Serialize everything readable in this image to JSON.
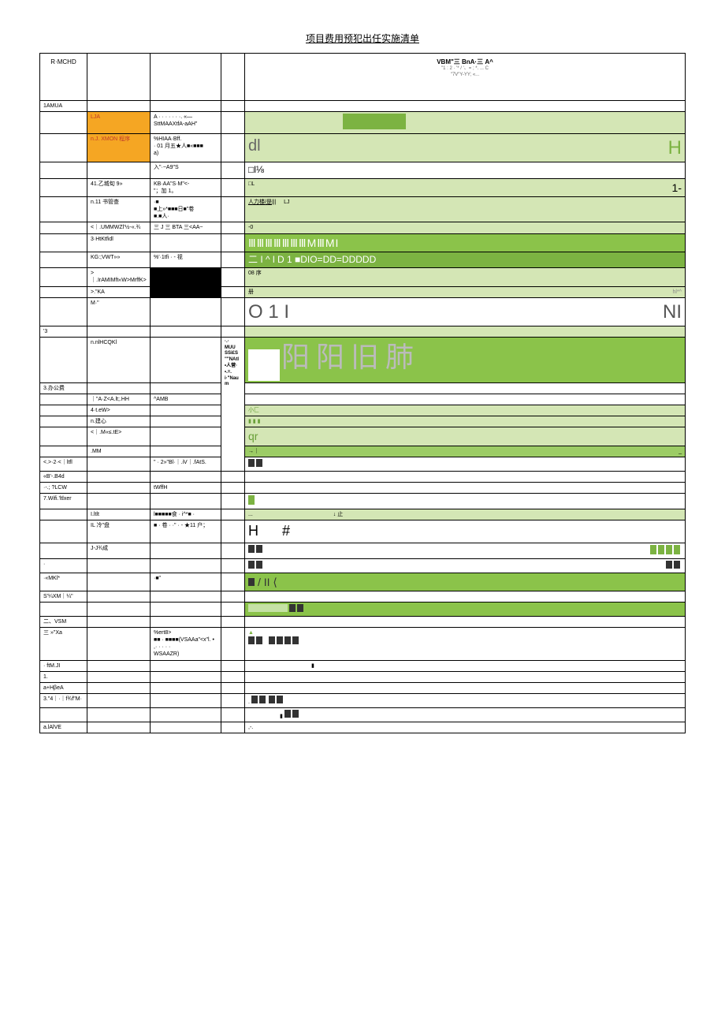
{
  "title": "项目费用预犯出任实施清单",
  "header": {
    "col1": "R·MCHD",
    "right_line1": "VBM\"三 BnA·三 A^",
    "right_line2": "\"1 : 2 · '* / '、= ; *. ... C",
    "right_line3": "\"7V\"Y-YY; «..."
  },
  "rows": [
    {
      "c1": "1AMUA",
      "c2": "",
      "c3": "",
      "c5": ""
    },
    {
      "c1": "",
      "c2": "LJA",
      "c2cls": "orange",
      "c3": "A · · · · · · ·. «—\nSttMAAXtfA-aAH\"",
      "c5cls": "lightgreen",
      "c5html": "<span style='position:relative;display:inline-block;width:100%'><span style='display:inline-block;width:80px;height:20px;background:#7cb342;margin-left:120px'></span></span>"
    },
    {
      "c1": "",
      "c2": "n.J. XMON 程序",
      "c2cls": "orange",
      "c3": "%HIAA·Bff.\n· 01 月五★人■«■■■\na)",
      "c5cls": "lightgreen",
      "c5html": "<span class='big-text'>dl</span><span style='float:right;font-size:24px;color:#7cb342'>H</span>"
    },
    {
      "c1": "",
      "c2": "",
      "c3": "入\"·~A9\"S",
      "c5": "□l⅛",
      "c5style": "font-size:12px"
    },
    {
      "c1": "",
      "c2": "41.乙城旬 9»",
      "c3": "KB·AA\"S·M\"<-\n\"；加 1。",
      "c5cls": "lightgreen",
      "c5html": "□L<span style='float:right;font-size:14px'>1-</span>"
    },
    {
      "c1": "",
      "c2": "n.11 书管查",
      "c3": "·■\n■上»*■■■日■\"卷\n■.■人·",
      "c5cls": "lightgreen",
      "c5html": "<u>人力楼/是</u>||| &nbsp;&nbsp;&nbsp; LJ"
    },
    {
      "c1": "",
      "c2": "<｜.UMMWZl'½-«.¾",
      "c3": "三 J 三 BTA 三<AA~",
      "c5cls": "lightgreen",
      "c5": "-0"
    },
    {
      "c1": "",
      "c2": "3·HtKtfidl",
      "c3": "",
      "c5cls": "brightgreen",
      "c5html": "<span style='font-size:14px;letter-spacing:1px'>ⅢⅢⅢⅢⅢⅢⅢMⅢMI</span>"
    },
    {
      "c1": "",
      "c2": "KG:;VWT»»",
      "c3": "%'·1tfi · - 视",
      "c5cls": "green",
      "c5html": "<span style='color:#fff;font-size:12px'>二 I ^ l D 1 ■DIO=DD=DDDDD</span>"
    },
    {
      "c1": "",
      "c2": ">｜.IrAMIMft«W>MrffK>",
      "c3": "",
      "c3cls": "black",
      "c5cls": "lightgreen",
      "c5": "08 序"
    },
    {
      "c1": "",
      "c2": ">.\"KA",
      "c3": "",
      "c3cls": "black",
      "c5cls": "lightgreen",
      "c5html": "册 <span style='float:right;color:#888'>hl*^</span>"
    },
    {
      "c1": "",
      "c2": "M·\"",
      "c3": "",
      "c5html": "<span class='big-dark'>O 1 I</span><span style='float:right;font-size:24px;color:#555'>NI</span>"
    },
    {
      "c1": "'3",
      "c2": "",
      "c3": "",
      "c5cls": "lightgreen",
      "c5": ""
    },
    {
      "c1": "",
      "c2": "n.nlHCQKl",
      "c3": "",
      "c4": "·.·\nMUU\nSSi£S\n\"\"NAtl\n•人营·\n•.=.\ni·\"Nau\nm",
      "c5cls": "brightgreen",
      "c5html": "<span style='display:inline-block;width:40px;height:40px;background:#fff;vertical-align:middle'></span> <span class='cjk-big'>阳阳旧肺</span>",
      "rowspan4": 8
    },
    {
      "c1": "3.办公费",
      "c2": "",
      "c3": "",
      "c5": ""
    },
    {
      "c1": "",
      "c2": "｜\"A·Z<A.lt;.HH",
      "c3": "^AMB",
      "c5": ""
    },
    {
      "c1": "",
      "c2": "4·t.eW>",
      "c3": "",
      "c5cls": "lightgreen",
      "c5": "小匚",
      "c5style": "color:#689f38"
    },
    {
      "c1": "",
      "c2": "n.建心",
      "c3": "",
      "c5cls": "lightgreen",
      "c5": "▮ ▮ ▮",
      "c5style": "color:#689f38"
    },
    {
      "c1": "",
      "c2": "<｜.M«≤.tE>",
      "c3": "",
      "c5cls": "lightgreen",
      "c5html": "<span style='font-size:14px;color:#689f38'>qr</span>"
    },
    {
      "c1": "",
      "c2": ".MM",
      "c3": "",
      "c5cls": "midgreen",
      "c5html": "→｜ <span style='float:right'>_</span>"
    },
    {
      "c1": "<.>·2·<｜ltfl",
      "c2": "",
      "c3": "\" · 2»\"Bl·｜.iV｜.fAtS.",
      "c5html": "<span class='bars'><span></span><span></span></span>"
    },
    {
      "c1": "«B'-.B4d",
      "c2": "",
      "c3": "",
      "c5": ""
    },
    {
      "c1": "·-.;  ?LCW",
      "c2": "",
      "c3": "tWffH",
      "c5": ""
    },
    {
      "c1": "7.Wifi.'ltlxer",
      "c2": "",
      "c3": "",
      "c5html": "<span class='bars-lg'><span></span></span>"
    },
    {
      "c1": "",
      "c2": "I.ltlt",
      "c3": "l■■■■■食 · i^*■ ·",
      "c5cls": "lightgreen",
      "c5html": "... <span style='margin-left:100px'>↓ 止</span>"
    },
    {
      "c1": "",
      "c2": "IL 冷\"盘",
      "c3": "■ · 卷 · ·\" · - ★11 户；",
      "c5html": "<span style='font-size:18px'>H &nbsp;&nbsp;&nbsp;&nbsp; #</span>"
    },
    {
      "c1": "",
      "c2": "J-J¾成",
      "c3": "",
      "c5html": "<span class='bars'><span></span><span></span></span> <span style='float:right' class='bars-lg'><span></span><span></span><span></span><span></span></span>"
    },
    {
      "c1": "·",
      "c2": "",
      "c3": "",
      "c5html": "<span class='bars'><span></span><span></span></span> <span style='float:right' class='bars'><span></span><span></span></span>"
    },
    {
      "c1": "·«MKl*",
      "c2": "",
      "c3": "·■\"",
      "c5cls": "brightgreen",
      "c5html": "<span class='bars'><span style='background:#333'></span></span> <span style='font-size:14px;color:#333'>/ II ⟨</span>"
    },
    {
      "c1": "S'¼XM｜¼\"",
      "c2": "",
      "c3": "",
      "c5": ""
    },
    {
      "c1": "",
      "c2": "",
      "c3": "",
      "c5cls": "brightgreen",
      "c5html": "<span style='display:inline-block;width:50px;height:10px;background:#c5e1a5'></span> <span class='bars'><span style='background:#333'></span><span style='background:#333'></span></span>"
    },
    {
      "c1": "二、VSM",
      "c2": "",
      "c3": "",
      "c5": ""
    },
    {
      "c1": "三 »\"Xa",
      "c2": "",
      "c3": "%ert8>\n■■ · ■■■■(VSAAa\"<x\"l. •\n,· · · · ·\nWSAAZR)",
      "c5html": "<span style='color:#7cb342'>▲</span><br><span class='bars'><span></span><span></span></span> &nbsp; <span class='bars'><span></span><span></span><span></span><span></span></span>"
    },
    {
      "c1": "· ftM.JI",
      "c2": "",
      "c3": "",
      "c5html": "<span style='margin-left:80px'>▮</span>"
    },
    {
      "c1": "1.",
      "c2": "",
      "c3": "",
      "c5": ""
    },
    {
      "c1": "a+HβeA",
      "c2": "",
      "c3": "",
      "c5": ""
    },
    {
      "c1": "3.\"4｜·｜f¾f\"M·",
      "c2": "",
      "c3": "",
      "c5html": ". <span class='bars'><span></span><span></span></span> <span class='bars'><span></span><span></span></span>"
    },
    {
      "c1": "",
      "c2": "",
      "c3": "",
      "c5html": "<span style='margin-left:40px'>▮</span> <span class='bars'><span></span><span></span></span>"
    },
    {
      "c1": "a.lAlVE",
      "c2": "",
      "c3": "",
      "c5html": ",-."
    }
  ]
}
